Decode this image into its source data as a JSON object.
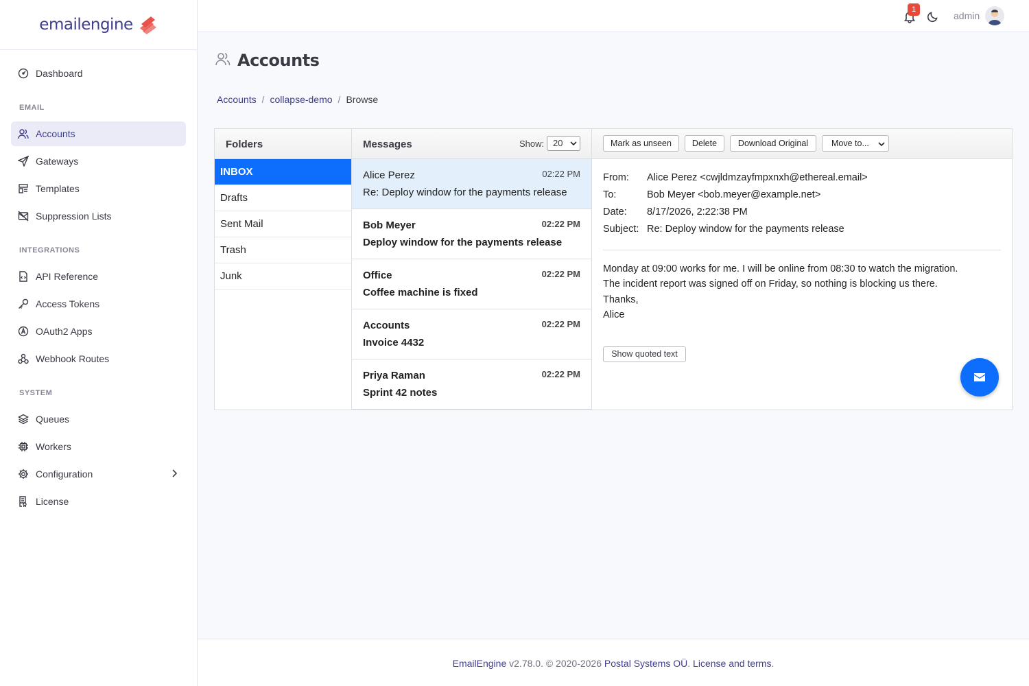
{
  "brand": {
    "name_light": "email",
    "name_bold": "engine"
  },
  "sidebar": {
    "dashboard": "Dashboard",
    "sections": {
      "email": "EMAIL",
      "integrations": "INTEGRATIONS",
      "system": "SYSTEM"
    },
    "email_items": [
      {
        "label": "Accounts",
        "icon": "users-icon"
      },
      {
        "label": "Gateways",
        "icon": "send-icon"
      },
      {
        "label": "Templates",
        "icon": "template-icon"
      },
      {
        "label": "Suppression Lists",
        "icon": "mail-off-icon"
      }
    ],
    "integration_items": [
      {
        "label": "API Reference",
        "icon": "file-code-icon"
      },
      {
        "label": "Access Tokens",
        "icon": "key-icon"
      },
      {
        "label": "OAuth2 Apps",
        "icon": "oauth-icon"
      },
      {
        "label": "Webhook Routes",
        "icon": "webhook-icon"
      }
    ],
    "system_items": [
      {
        "label": "Queues",
        "icon": "layers-icon"
      },
      {
        "label": "Workers",
        "icon": "cpu-icon"
      },
      {
        "label": "Configuration",
        "icon": "gear-icon"
      },
      {
        "label": "License",
        "icon": "license-icon"
      }
    ]
  },
  "topbar": {
    "notification_count": "1",
    "user": "admin"
  },
  "page": {
    "title": "Accounts"
  },
  "breadcrumb": {
    "root": "Accounts",
    "account": "collapse-demo",
    "current": "Browse"
  },
  "folders": {
    "header": "Folders",
    "items": [
      "INBOX",
      "Drafts",
      "Sent Mail",
      "Trash",
      "Junk"
    ]
  },
  "messages": {
    "header": "Messages",
    "show_label": "Show:",
    "show_value": "20",
    "items": [
      {
        "from": "Alice Perez",
        "time": "02:22 PM",
        "subject": "Re: Deploy window for the payments release"
      },
      {
        "from": "Bob Meyer",
        "time": "02:22 PM",
        "subject": "Deploy window for the payments release"
      },
      {
        "from": "Office",
        "time": "02:22 PM",
        "subject": "Coffee machine is fixed"
      },
      {
        "from": "Accounts",
        "time": "02:22 PM",
        "subject": "Invoice 4432"
      },
      {
        "from": "Priya Raman",
        "time": "02:22 PM",
        "subject": "Sprint 42 notes"
      }
    ]
  },
  "reader": {
    "buttons": {
      "mark_unseen": "Mark as unseen",
      "delete": "Delete",
      "download": "Download Original",
      "move": "Move to..."
    },
    "headers": {
      "from_label": "From:",
      "from": "Alice Perez <cwjldmzayfmpxnxh@ethereal.email>",
      "to_label": "To:",
      "to": "Bob Meyer <bob.meyer@example.net>",
      "date_label": "Date:",
      "date": "8/17/2026, 2:22:38 PM",
      "subject_label": "Subject:",
      "subject": "Re: Deploy window for the payments release"
    },
    "body": [
      "Monday at 09:00 works for me. I will be online from 08:30 to watch the migration.",
      "The incident report was signed off on Friday, so nothing is blocking us there.",
      "Thanks,",
      "Alice"
    ],
    "show_quoted": "Show quoted text"
  },
  "footer": {
    "product": "EmailEngine",
    "version": " v2.78.0. © 2020-2026 ",
    "company": "Postal Systems OÜ",
    "license": "License and terms"
  },
  "colors": {
    "accent": "#3f3d8f",
    "primary": "#0d6efd",
    "badge": "#e74a3b",
    "selected_row": "#e3f0fb"
  }
}
